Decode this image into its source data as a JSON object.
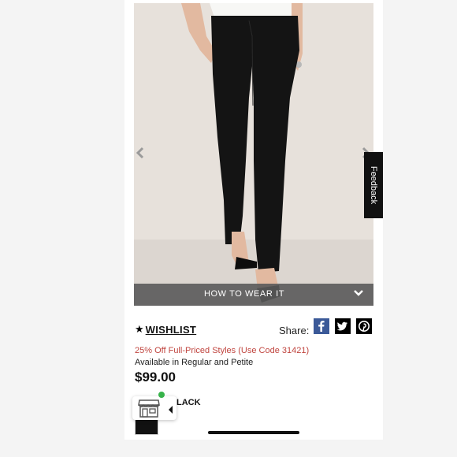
{
  "carousel": {
    "prev_icon": "chevron-left-icon",
    "next_icon": "chevron-right-icon",
    "how_to_wear": "HOW TO WEAR IT"
  },
  "feedback_tab": "Feedback",
  "wishlist": {
    "label": "WISHLIST",
    "icon": "star-icon"
  },
  "share": {
    "label": "Share:",
    "networks": [
      "facebook",
      "twitter",
      "pinterest"
    ],
    "colors": {
      "facebook": "#3b5998",
      "twitter": "#000000",
      "pinterest": "#000000"
    }
  },
  "promo_text": "25% Off Full-Priced Styles (Use Code 31421)",
  "availability": "Available in Regular and Petite",
  "price": "$99.00",
  "color": {
    "name": "BLACK",
    "swatch": "#111111",
    "visible_label": "LACK"
  },
  "store_widget": {
    "icon": "storefront-icon",
    "status_color": "#37b34a"
  },
  "colors": {
    "promo": "#c0453f",
    "banner": "#5a5a5a",
    "page_bg": "#f4f4f4"
  }
}
